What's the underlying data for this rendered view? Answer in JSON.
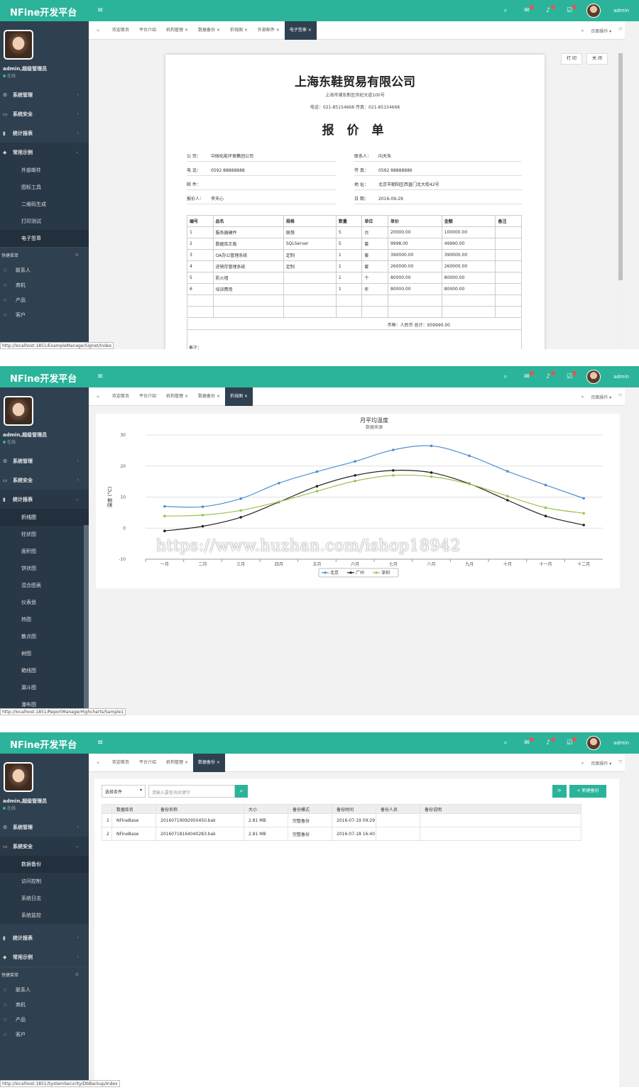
{
  "app": {
    "logo": "NFine开发平台",
    "user": "admin",
    "profile_name": "admin,超级管理员",
    "profile_status": "在线",
    "menu_icon": "≡"
  },
  "nav": {
    "sys_manage": "系统管理",
    "sys_security": "系统安全",
    "stat_report": "统计报表",
    "common_examples": "常用示例",
    "shortcut_title": "快捷菜单",
    "shortcuts": [
      "联系人",
      "商机",
      "产品",
      "客户"
    ]
  },
  "screen1": {
    "examples_sub": [
      "外部邮件",
      "图标工具",
      "二维码生成",
      "打印测试",
      "电子签章"
    ],
    "tabs": [
      "欢迎首页",
      "平台介绍",
      "机构管理",
      "数据备份",
      "折线图",
      "外部邮件",
      "电子签章"
    ],
    "tab_ops": "页面操作",
    "status_url": "http://localhost:1851/ExampleManage/Signet/Index",
    "buttons": {
      "print": "打 印",
      "close": "关 闭"
    },
    "quote": {
      "company": "上海东鞋贸易有限公司",
      "address": "上海市浦东新区世纪大道100号",
      "contact": "电话：021-85154668   传真：021-85154668",
      "title": "报 价 单",
      "fields": {
        "company_label": "公  司：",
        "company": "中国化能环保集团公司",
        "contact_label": "联系人：",
        "contact": "向天朱",
        "phone_label": "电  话：",
        "phone": "0592 88888888",
        "fax_label": "传  真：",
        "fax": "0592 88888886",
        "email_label": "邮  件：",
        "email": "",
        "addr_label": "地  址：",
        "addr": "北京市朝阳区西直门北大街42号",
        "quoter_label": "报价人：",
        "quoter": "李天心",
        "date_label": "日  期：",
        "date": "2016-09-29"
      },
      "columns": [
        "编号",
        "品名",
        "规格",
        "数量",
        "单位",
        "单价",
        "金额",
        "备注"
      ],
      "rows": [
        [
          "1",
          "服务器硬件",
          "联想",
          "5",
          "台",
          "20000.00",
          "100000.00",
          ""
        ],
        [
          "2",
          "数据库正版",
          "SQLServer",
          "5",
          "套",
          "9998.00",
          "49990.00",
          ""
        ],
        [
          "3",
          "OA办公管理系统",
          "定制",
          "1",
          "套",
          "390000.00",
          "390000.00",
          ""
        ],
        [
          "4",
          "进销存管理系统",
          "定制",
          "1",
          "套",
          "260000.00",
          "260000.00",
          ""
        ],
        [
          "5",
          "防火墙",
          "",
          "1",
          "个",
          "80000.00",
          "80000.00",
          ""
        ],
        [
          "6",
          "培训费用",
          "",
          "1",
          "年",
          "80000.00",
          "80000.00",
          ""
        ]
      ],
      "total": "币种：人民币    总计：959990.00",
      "remark": "备注："
    }
  },
  "screen2": {
    "report_sub": [
      "折线图",
      "柱状图",
      "面积图",
      "饼状图",
      "混合图表",
      "仪表盘",
      "热图",
      "散点图",
      "树图",
      "箱线图",
      "漏斗图",
      "瀑布图"
    ],
    "tabs": [
      "欢迎首页",
      "平台介绍",
      "机构管理",
      "数据备份",
      "折线图"
    ],
    "tab_ops": "页面操作",
    "status_url": "http://localhost:1851/ReportManage/Highcharts/Sample1",
    "watermark": "https://www.huzhan.com/ishop18942"
  },
  "chart_data": {
    "type": "line",
    "title": "月平均温度",
    "subtitle": "数据来源",
    "ylabel": "温度 (°C)",
    "ylim": [
      -10,
      30
    ],
    "yticks": [
      "30",
      "20",
      "10",
      "0",
      "-10"
    ],
    "categories": [
      "一月",
      "二月",
      "三月",
      "四月",
      "五月",
      "六月",
      "七月",
      "八月",
      "九月",
      "十月",
      "十一月",
      "十二月"
    ],
    "legend_position": "bottom",
    "grid": true,
    "series": [
      {
        "name": "北京",
        "color": "#4f90d0",
        "values": [
          7.0,
          6.9,
          9.5,
          14.5,
          18.2,
          21.5,
          25.2,
          26.5,
          23.3,
          18.3,
          13.9,
          9.6
        ]
      },
      {
        "name": "广州",
        "color": "#222222",
        "values": [
          -0.9,
          0.6,
          3.5,
          8.4,
          13.5,
          17.0,
          18.6,
          17.9,
          14.3,
          9.0,
          3.9,
          1.0
        ]
      },
      {
        "name": "深圳",
        "color": "#9bc34f",
        "values": [
          3.9,
          4.2,
          5.7,
          8.5,
          11.9,
          15.2,
          17.0,
          16.6,
          14.2,
          10.3,
          6.6,
          4.8
        ]
      }
    ]
  },
  "screen3": {
    "security_sub": [
      "数据备份",
      "访问控制",
      "系统日志",
      "系统监控"
    ],
    "tabs": [
      "欢迎首页",
      "平台介绍",
      "机构管理",
      "数据备份"
    ],
    "tab_ops": "页面操作",
    "status_url": "http://localhost:1851/SystemSecurity/DbBackup/Index",
    "select_value": "选择条件",
    "search_placeholder": "请输入要查询关键字",
    "refresh_icon": "⟳",
    "new_backup": "新建备份",
    "columns": [
      "",
      "数据库名",
      "备份名称",
      "大小",
      "备份模式",
      "备份时间",
      "备份人员",
      "备份说明"
    ],
    "rows": [
      [
        "1",
        "NFineBase",
        "20160719092950450.bak",
        "2.81 MB",
        "完整备份",
        "2016-07-19 09:29",
        "",
        ""
      ],
      [
        "2",
        "NFineBase",
        "20160718164040283.bak",
        "2.81 MB",
        "完整备份",
        "2016-07-18 16:40",
        "",
        ""
      ]
    ]
  }
}
